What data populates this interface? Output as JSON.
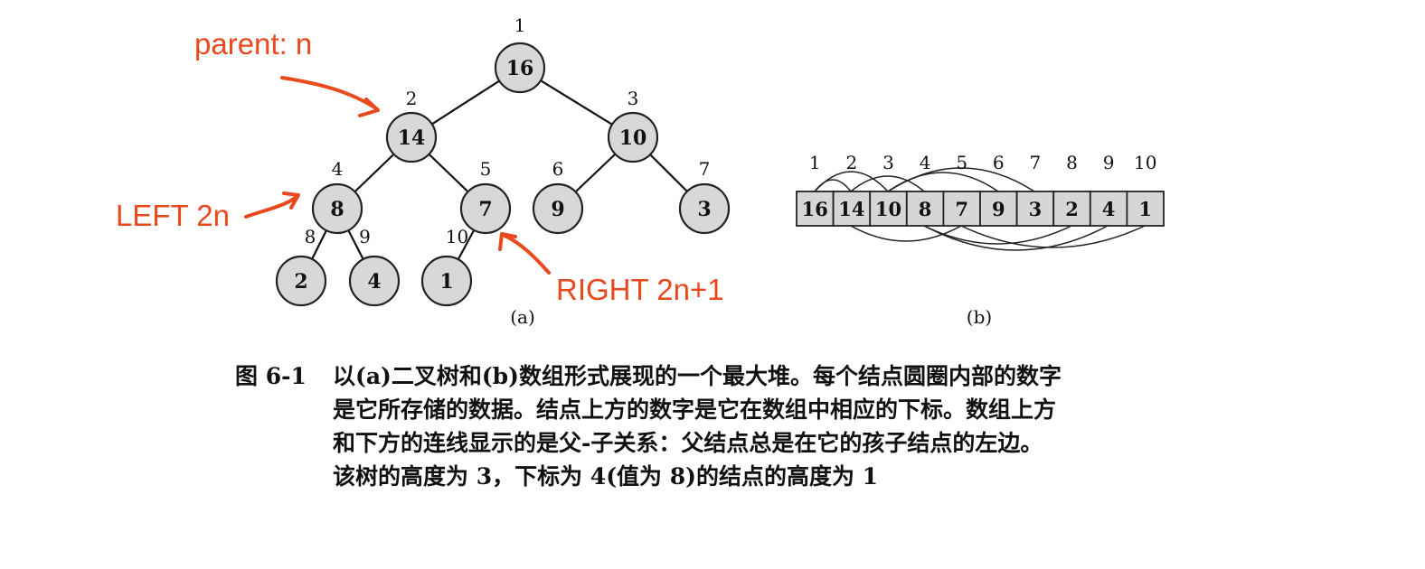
{
  "heap": {
    "values": [
      16,
      14,
      10,
      8,
      7,
      9,
      3,
      2,
      4,
      1
    ],
    "indices": [
      "1",
      "2",
      "3",
      "4",
      "5",
      "6",
      "7",
      "8",
      "9",
      "10"
    ]
  },
  "subfigure_labels": {
    "a": "(a)",
    "b": "(b)"
  },
  "annotations": {
    "parent": "parent: n",
    "left": "LEFT 2n",
    "right": "RIGHT 2n+1",
    "color": "#e8491d"
  },
  "caption": {
    "id": "图 6-1",
    "lines": [
      "以(a)二叉树和(b)数组形式展现的一个最大堆。每个结点圆圈内部的数字",
      "是它所存储的数据。结点上方的数字是它在数组中相应的下标。数组上方",
      "和下方的连线显示的是父-子关系：父结点总是在它的孩子结点的左边。",
      "该树的高度为 3，下标为 4(值为 8)的结点的高度为 1"
    ]
  }
}
